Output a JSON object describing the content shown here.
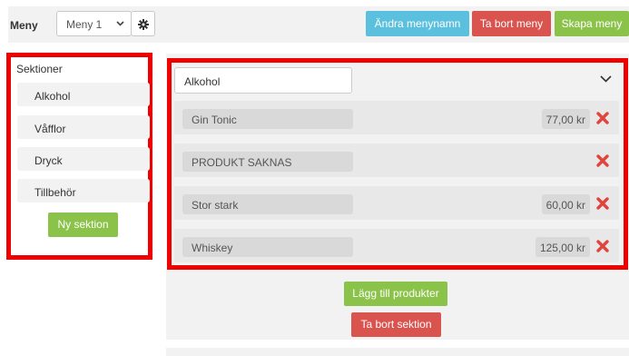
{
  "header": {
    "menu_label": "Meny",
    "menu_select_value": "Meny 1",
    "rename_button": "Ändra menynamn",
    "delete_menu_button": "Ta bort meny",
    "create_menu_button": "Skapa meny"
  },
  "sidebar": {
    "title": "Sektioner",
    "items": [
      {
        "label": "Alkohol"
      },
      {
        "label": "Våfflor"
      },
      {
        "label": "Dryck"
      },
      {
        "label": "Tillbehör"
      }
    ],
    "new_section_button": "Ny sektion"
  },
  "section": {
    "name_value": "Alkohol",
    "products": [
      {
        "name": "Gin Tonic",
        "price": "77,00 kr"
      },
      {
        "name": "PRODUKT SAKNAS",
        "price": ""
      },
      {
        "name": "Stor stark",
        "price": "60,00 kr"
      },
      {
        "name": "Whiskey",
        "price": "125,00 kr"
      }
    ],
    "add_products_button": "Lägg till produkter",
    "delete_section_button": "Ta bort sektion"
  },
  "colors": {
    "highlight_outline": "#ee0000",
    "delete_icon": "#e0443c",
    "blue_button": "#5bc0de",
    "red_button": "#d9534f",
    "green_button": "#8bc34a"
  },
  "icons": {
    "settings": "gear-icon",
    "collapse": "chevron-down-icon",
    "delete": "close-icon"
  }
}
